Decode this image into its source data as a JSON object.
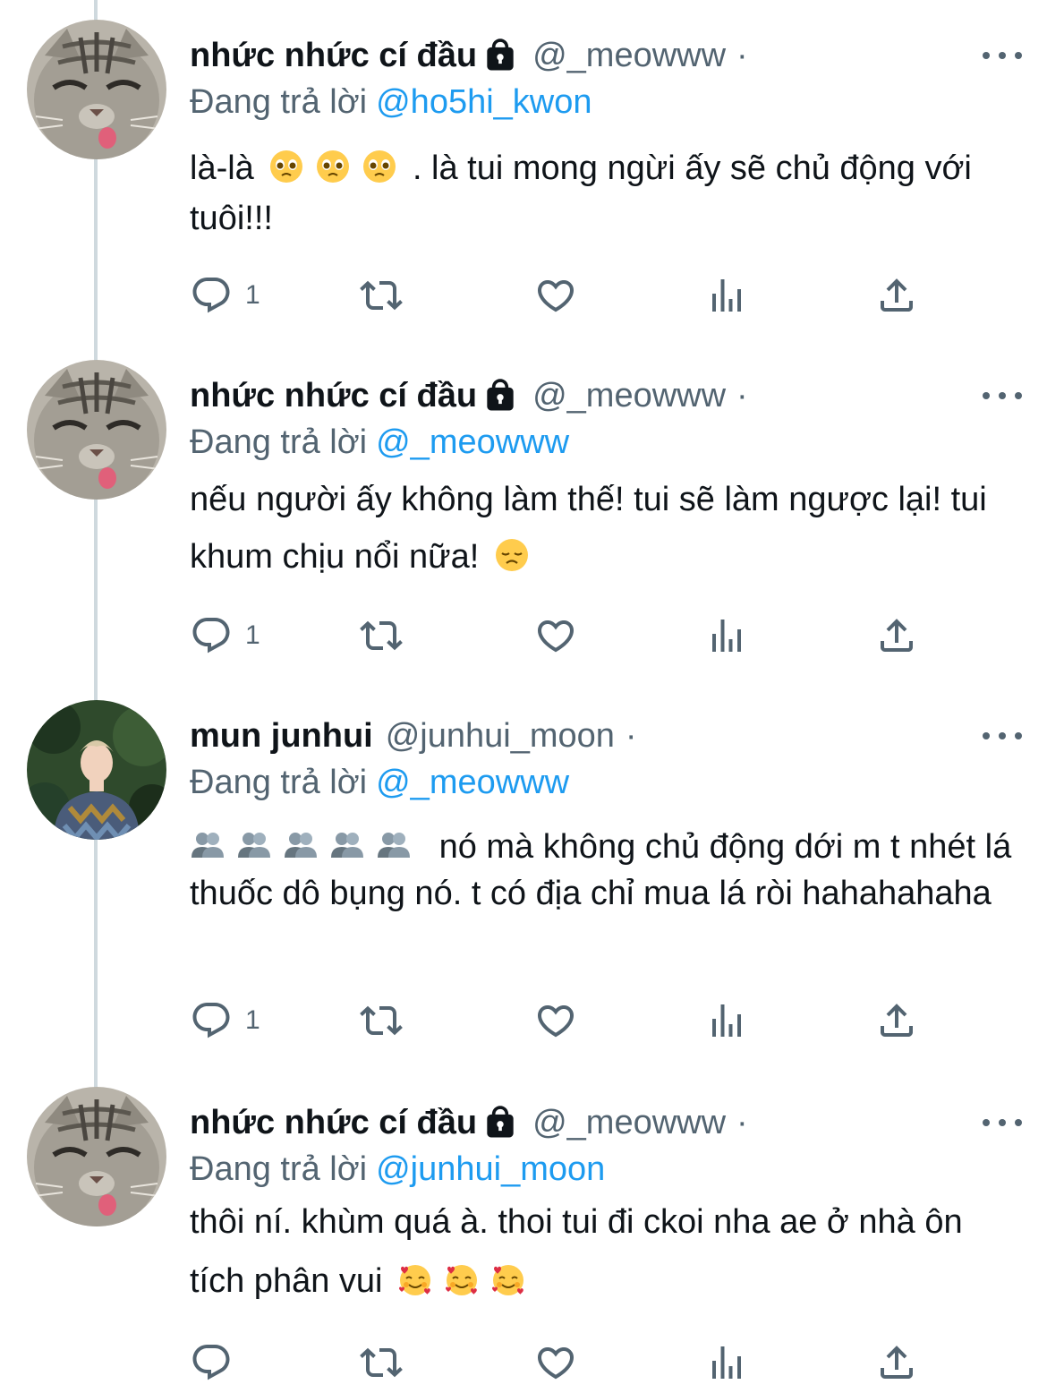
{
  "tweets": [
    {
      "name": "nhức nhức cí đầu",
      "locked": true,
      "handle": "@_meowww",
      "dot": "·",
      "replying_label": "Đang trả lời",
      "replying_to": "@ho5hi_kwon",
      "text_before": "là-là",
      "emojis_inline": [
        "pleading-face-emoji",
        "pleading-face-emoji",
        "pleading-face-emoji"
      ],
      "text_after": ". là tui mong ngừi ấy sẽ chủ động với tuôi!!!",
      "reply_count": "1",
      "avatar": "cat-avatar"
    },
    {
      "name": "nhức nhức cí đầu",
      "locked": true,
      "handle": "@_meowww",
      "dot": "·",
      "replying_label": "Đang trả lời",
      "replying_to": "@_meowww",
      "text_line": "nếu người ấy không làm thế! tui sẽ làm ngược lại! tui khum chịu nổi nữa!",
      "emoji_end": "disappointed-face-emoji",
      "reply_count": "1",
      "avatar": "cat-avatar"
    },
    {
      "name": "mun junhui",
      "locked": false,
      "handle": "@junhui_moon",
      "dot": "·",
      "replying_label": "Đang trả lời",
      "replying_to": "@_meowww",
      "emojis_start": [
        "busts-emoji",
        "busts-emoji",
        "busts-emoji",
        "busts-emoji",
        "busts-emoji"
      ],
      "text_line": "nó mà không chủ động dới m t nhét lá thuốc dô bụng nó. t có địa chỉ mua lá ròi hahahahaha",
      "reply_count": "1",
      "avatar": "person-avatar"
    },
    {
      "name": "nhức nhức cí đầu",
      "locked": true,
      "handle": "@_meowww",
      "dot": "·",
      "replying_label": "Đang trả lời",
      "replying_to": "@junhui_moon",
      "text_line": "thôi ní. khùm quá à. thoi tui đi ckoi nha ae ở nhà ôn tích phân vui",
      "emojis_end": [
        "smiling-face-with-hearts-emoji",
        "smiling-face-with-hearts-emoji",
        "smiling-face-with-hearts-emoji"
      ],
      "reply_count": "",
      "avatar": "cat-avatar"
    }
  ],
  "colors": {
    "text": "#0f1419",
    "secondary": "#536471",
    "link": "#1d9bf0",
    "thread_line": "#cfd9de"
  },
  "action_icons": [
    "reply-icon",
    "retweet-icon",
    "like-icon",
    "views-icon",
    "share-icon"
  ]
}
